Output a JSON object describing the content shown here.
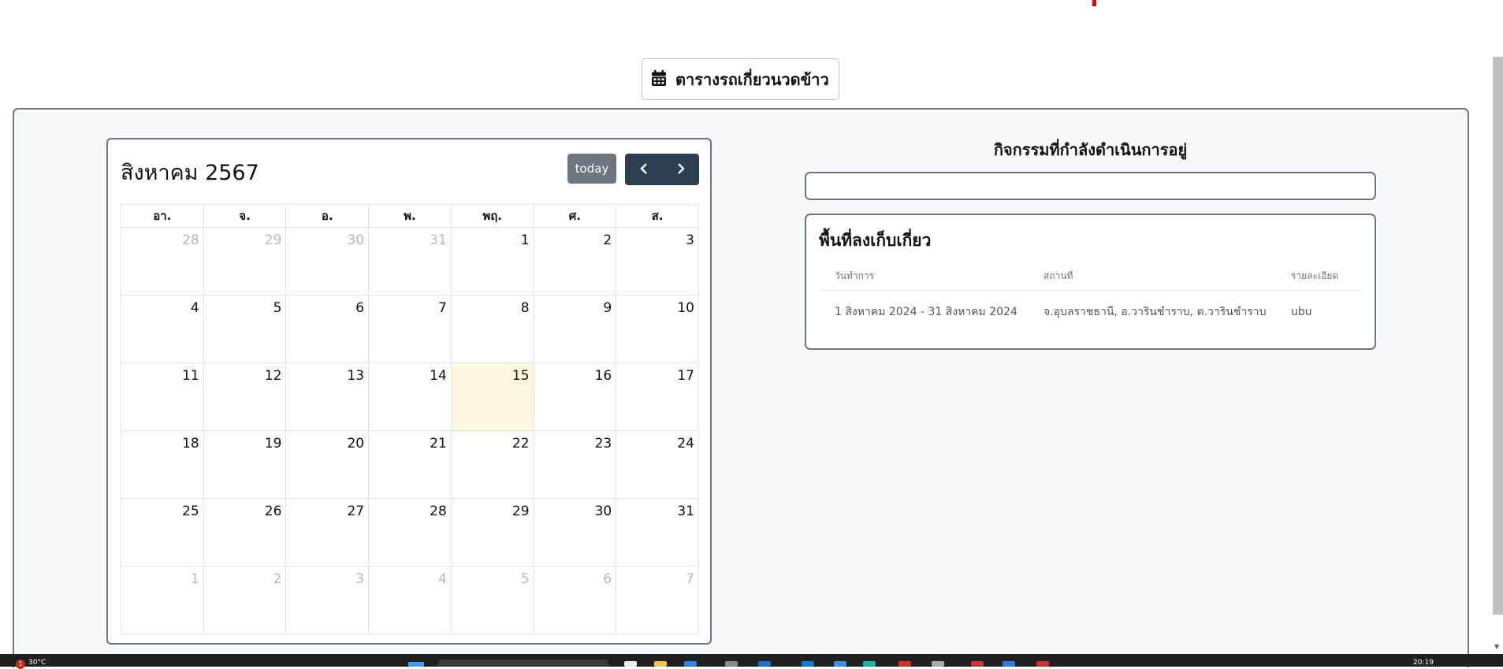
{
  "header": {
    "title_button": "ตารางรถเกี่ยวนวดข้าว",
    "icon": "calendar-icon"
  },
  "calendar": {
    "title": "สิงหาคม 2567",
    "today_label": "today",
    "prev_icon": "chevron-left-icon",
    "next_icon": "chevron-right-icon",
    "weekdays": [
      "อา.",
      "จ.",
      "อ.",
      "พ.",
      "พฤ.",
      "ศ.",
      "ส."
    ],
    "weeks": [
      [
        "28",
        "29",
        "30",
        "31",
        "1",
        "2",
        "3"
      ],
      [
        "4",
        "5",
        "6",
        "7",
        "8",
        "9",
        "10"
      ],
      [
        "11",
        "12",
        "13",
        "14",
        "15",
        "16",
        "17"
      ],
      [
        "18",
        "19",
        "20",
        "21",
        "22",
        "23",
        "24"
      ],
      [
        "25",
        "26",
        "27",
        "28",
        "29",
        "30",
        "31"
      ],
      [
        "1",
        "2",
        "3",
        "4",
        "5",
        "6",
        "7"
      ]
    ],
    "highlight_color": "#fff8de"
  },
  "activity": {
    "title": "กิจกรรมที่กำลังดำเนินการอยู่"
  },
  "harvest_area": {
    "title": "พื้นที่ลงเก็บเกี่ยว",
    "columns": [
      "วันทำการ",
      "สถานที่",
      "รายละเอียด"
    ],
    "rows": [
      [
        "1 สิงหาคม 2024 - 31 สิงหาคม 2024",
        "จ.อุบลราชธานี, อ.วารินชำราบ, ต.วารินชำราบ",
        "ubu"
      ]
    ]
  },
  "taskbar": {
    "notification_count": "1",
    "weather": "30°C",
    "time": "20:19"
  },
  "colors": {
    "accent_dark": "#2c3e50",
    "secondary": "#6c757d"
  }
}
